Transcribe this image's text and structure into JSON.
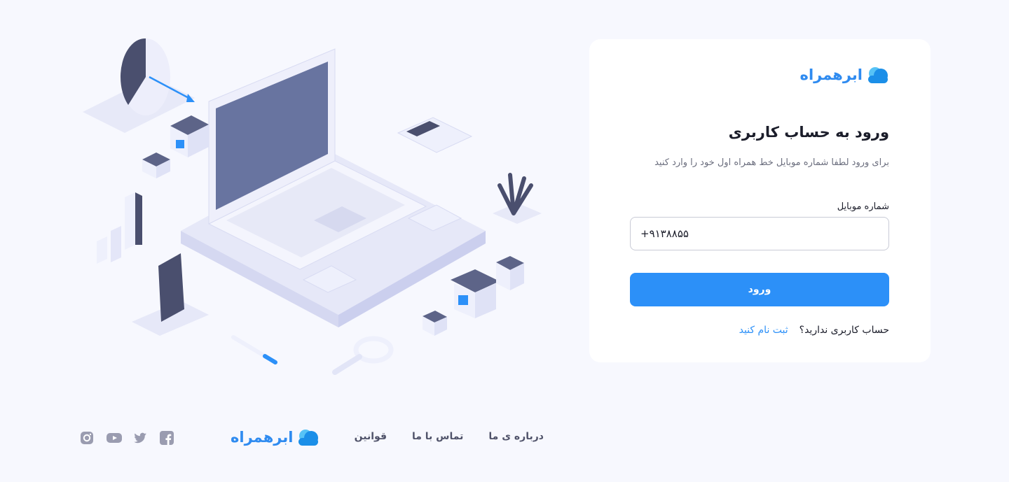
{
  "brand": {
    "name": "ابرهمراه",
    "accent": "#2c90f8"
  },
  "login": {
    "title": "ورود به حساب کاربری",
    "subtitle": "برای ورود لطفا شماره موبایل خط همراه اول خود را وارد کنید",
    "mobile_label": "شماره موبایل",
    "mobile_value": "+۹۱۳۸۸۵۵",
    "submit_label": "ورود",
    "no_account_text": "حساب کاربری ندارید؟",
    "signup_link": "ثبت نام کنید"
  },
  "footer": {
    "links": [
      "درباره ی ما",
      "تماس با ما",
      "قوانین"
    ],
    "social_icons": [
      "facebook-icon",
      "twitter-icon",
      "youtube-icon",
      "instagram-icon"
    ]
  }
}
